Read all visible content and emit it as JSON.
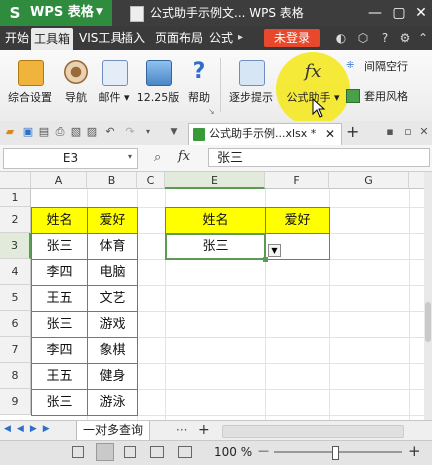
{
  "title_bar": {
    "app_logo": "S",
    "app_name": "WPS 表格",
    "document_title": "公式助手示例文... WPS 表格"
  },
  "menu": {
    "items": [
      "开始",
      "工具箱",
      "VIS工具",
      "插入",
      "页面布局",
      "公式"
    ],
    "active_index": 1,
    "login_label": "未登录"
  },
  "ribbon": {
    "buttons": [
      {
        "label": "综合设置",
        "icon": "settings-icon"
      },
      {
        "label": "导航",
        "icon": "wheel-icon"
      },
      {
        "label": "邮件 ▾",
        "icon": "mail-icon"
      },
      {
        "label": "12.25版",
        "icon": "image-icon"
      },
      {
        "label": "帮助",
        "icon": "help-icon"
      },
      {
        "label": "逐步提示",
        "icon": "step-icon"
      },
      {
        "label": "公式助手 ▾",
        "icon": "fx-icon"
      }
    ],
    "small_buttons": [
      {
        "label": "间隔空行",
        "icon": "blank-row-icon"
      },
      {
        "label": "套用风格",
        "icon": "style-icon"
      }
    ],
    "fx_symbol": "fx"
  },
  "tab_bar": {
    "doc_tab_label": "公式助手示例...xlsx *",
    "add_symbol": "+"
  },
  "formula_bar": {
    "name_box": "E3",
    "fx_label": "fx",
    "formula": "张三"
  },
  "sheet": {
    "columns": [
      "A",
      "B",
      "C",
      "D",
      "E",
      "F",
      "G"
    ],
    "rows": [
      "1",
      "2",
      "3",
      "4",
      "5",
      "6",
      "7",
      "8",
      "9"
    ],
    "selected_cell": "E3",
    "left_table": {
      "headers": [
        "姓名",
        "爱好"
      ],
      "rows": [
        [
          "张三",
          "体育"
        ],
        [
          "李四",
          "电脑"
        ],
        [
          "王五",
          "文艺"
        ],
        [
          "张三",
          "游戏"
        ],
        [
          "李四",
          "象棋"
        ],
        [
          "王五",
          "健身"
        ],
        [
          "张三",
          "游泳"
        ]
      ]
    },
    "right_table": {
      "headers": [
        "姓名",
        "爱好"
      ],
      "value": "张三"
    },
    "colors": {
      "header_fill": "#ffff00",
      "selection": "#5a9c54"
    }
  },
  "sheet_bar": {
    "sheet_tab": "一对多查询",
    "dots": "···",
    "add": "+"
  },
  "status_bar": {
    "zoom": "100 %",
    "minus": "—",
    "plus": "+"
  }
}
